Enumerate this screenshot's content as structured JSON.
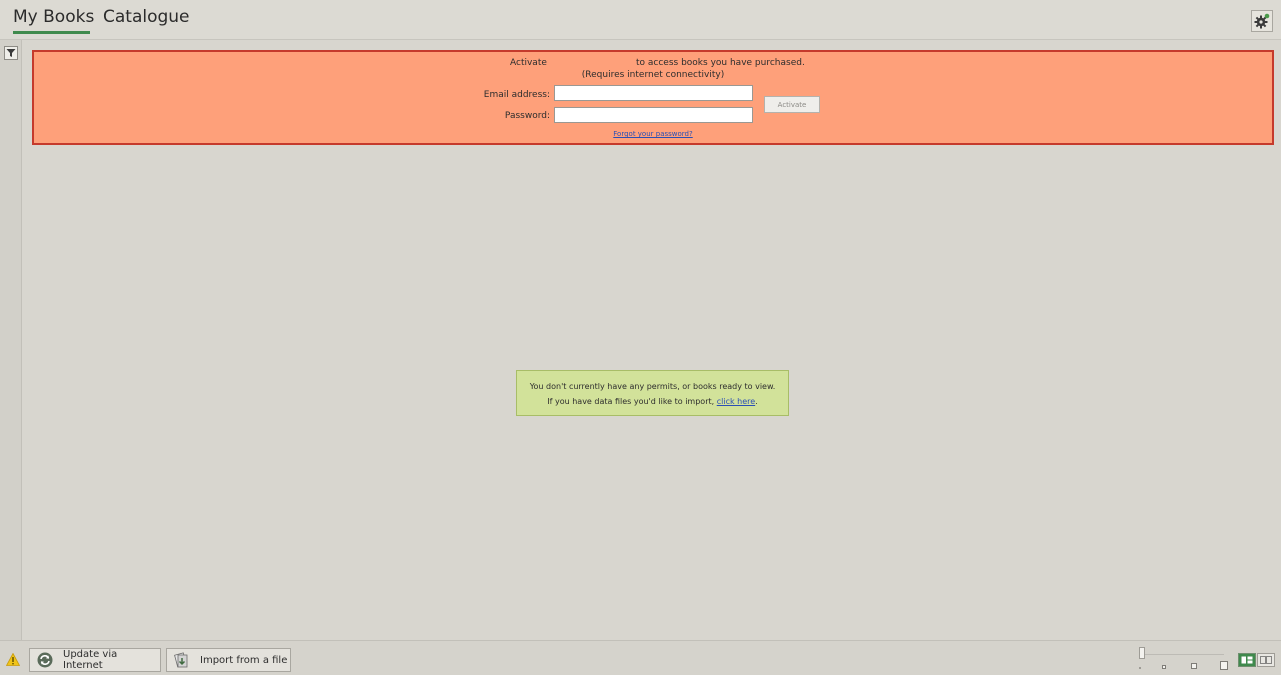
{
  "tabs": [
    {
      "label": "My Books",
      "active": true
    },
    {
      "label": "Catalogue",
      "active": false
    }
  ],
  "activation": {
    "line1_start": "Activate",
    "line1_end": "to access books you have purchased.",
    "line2": "(Requires internet connectivity)",
    "email_label": "Email address:",
    "email_value": "",
    "password_label": "Password:",
    "password_value": "",
    "activate_button": "Activate",
    "forgot_link": "Forgot your password?",
    "background_color": "#fea07a",
    "border_color": "#c53a2c"
  },
  "notice": {
    "line1": "You don't currently have any permits, or books ready to view.",
    "line2_prefix": "If you have data files you'd like to import,",
    "line2_link": "click here",
    "line2_suffix": ".",
    "background_color": "#d2e29a"
  },
  "bottom_bar": {
    "update_button": "Update via Internet",
    "import_button": "Import from a file"
  },
  "icons": {
    "settings": "gear-icon",
    "filter": "filter-icon",
    "warning": "warning-icon",
    "update": "refresh-icon",
    "import": "import-icon"
  },
  "accent_color": "#3f8a4d"
}
